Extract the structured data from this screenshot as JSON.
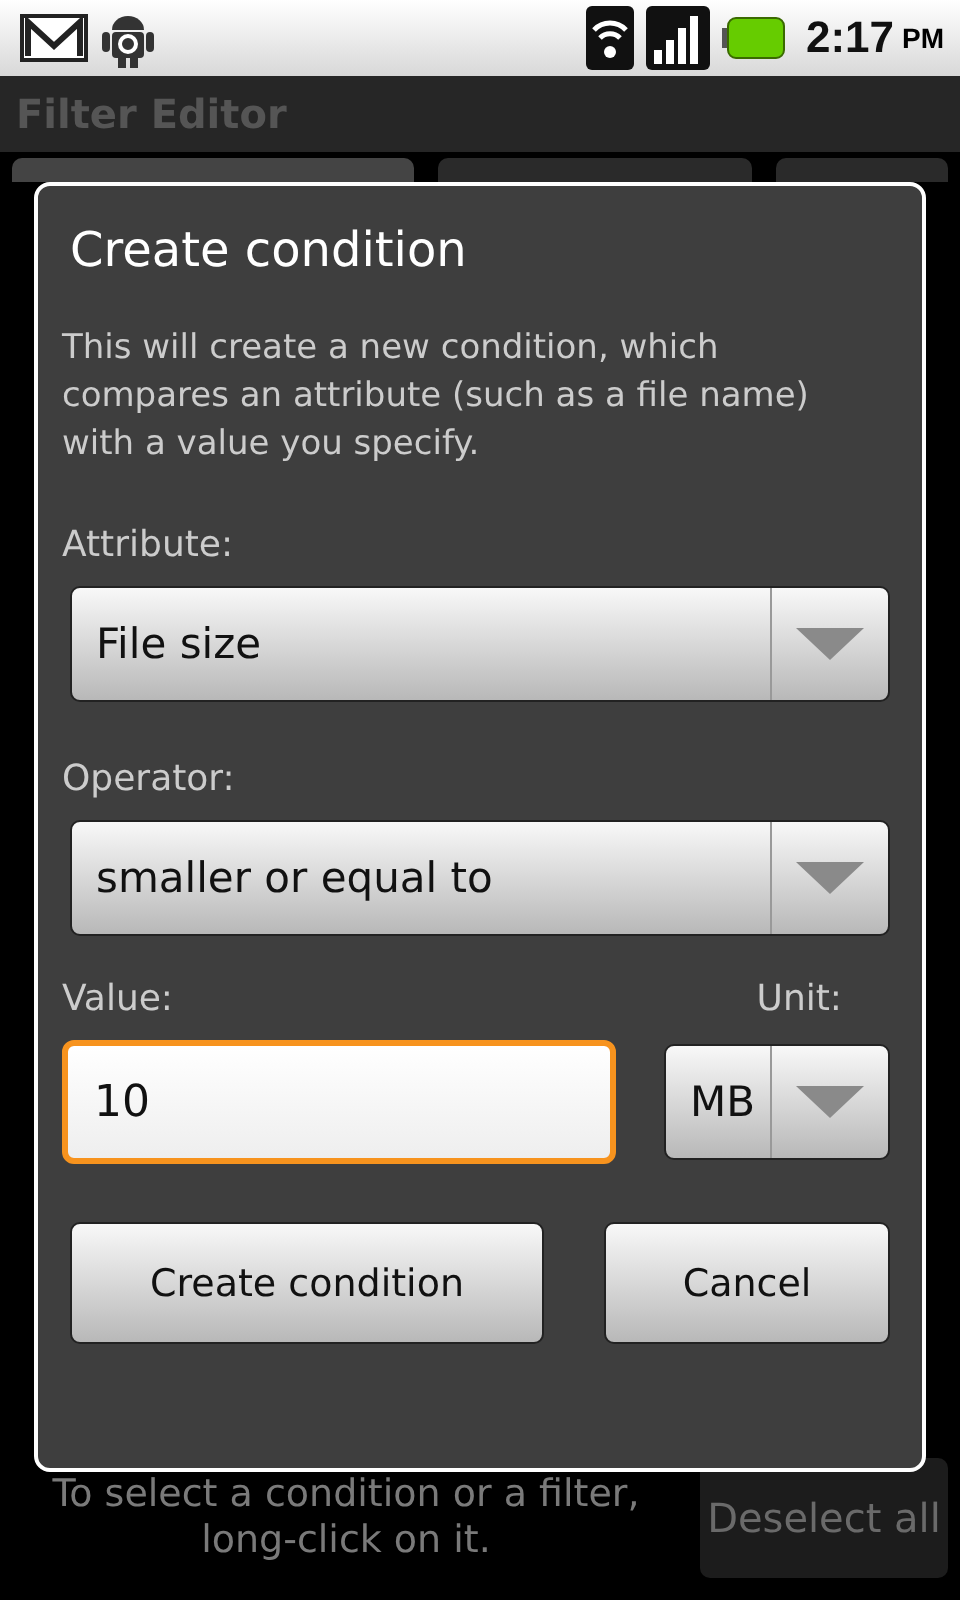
{
  "status_bar": {
    "time": "2:17",
    "am_pm": "PM"
  },
  "app": {
    "title": "Filter Editor"
  },
  "dialog": {
    "title": "Create condition",
    "message": "This will create a new condition, which compares an attribute (such as a file name) with a value you specify.",
    "spinners": [
      {
        "label": "Attribute:",
        "value": "File size"
      },
      {
        "label": "Operator:",
        "value": "smaller or equal to"
      }
    ],
    "value_field": {
      "label": "Value:",
      "value": "10",
      "focused": true
    },
    "unit": {
      "label": "Unit:",
      "value": "MB"
    },
    "buttons": [
      "Create condition",
      "Cancel"
    ]
  },
  "footer": {
    "hint": "To select a condition or a filter, long-click on it.",
    "button": "Deselect all"
  }
}
